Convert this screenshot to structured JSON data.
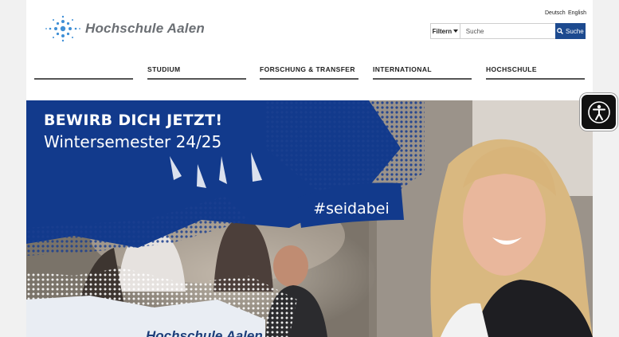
{
  "header": {
    "logo_text": "Hochschule Aalen",
    "languages": [
      "Deutsch",
      "English"
    ],
    "filter_label": "Filtern",
    "search_placeholder": "Suche",
    "search_button": "Suche"
  },
  "nav": {
    "items": [
      "STUDIUM",
      "FORSCHUNG & TRANSFER",
      "INTERNATIONAL",
      "HOCHSCHULE"
    ]
  },
  "hero": {
    "headline": "BEWIRB DICH JETZT!",
    "subheadline": "Wintersemester 24/25",
    "hashtag": "#seidabei",
    "bottom_logo_text": "Hochschule Aalen"
  },
  "accessibility": {
    "icon": "accessibility-icon"
  },
  "colors": {
    "brand_blue": "#1d4a8f",
    "hero_blue": "#123a8c",
    "logo_grey": "#6b6f74"
  }
}
